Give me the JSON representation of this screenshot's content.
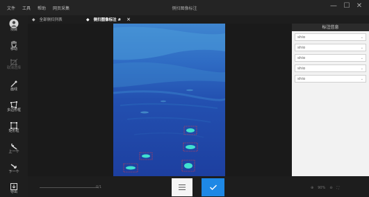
{
  "menu": [
    "文件",
    "工具",
    "帮助",
    "网页采集"
  ],
  "window_title": "侧扫图像标注",
  "window_controls": {
    "minimize": "—",
    "maximize": "☐",
    "close": "✕"
  },
  "tabs": [
    {
      "label": "全部侧扫列表",
      "active": false
    },
    {
      "label": "侧扫图像标注 #",
      "active": true,
      "close": "×"
    }
  ],
  "tools": [
    {
      "label": "项目",
      "icon": "avatar-icon",
      "enabled": true
    },
    {
      "label": "移动",
      "icon": "hand-icon",
      "enabled": true
    },
    {
      "label": "取消选择",
      "icon": "crop-icon",
      "enabled": false
    },
    {
      "label": "画线",
      "icon": "pen-icon",
      "enabled": true
    },
    {
      "label": "多边形框",
      "icon": "polygon-icon",
      "enabled": true
    },
    {
      "label": "矩形框",
      "icon": "rectangle-icon",
      "enabled": true
    },
    {
      "label": "上一个",
      "icon": "undo-icon",
      "enabled": true
    },
    {
      "label": "下一个",
      "icon": "redo-icon",
      "enabled": true
    },
    {
      "label": "导出",
      "icon": "export-icon",
      "enabled": true
    }
  ],
  "panel": {
    "title": "标注信息",
    "items": [
      "shio",
      "shio",
      "shio",
      "shio",
      "shio"
    ]
  },
  "bottom": {
    "slider_value": "0/1",
    "zoom_text": "90%"
  },
  "colors": {
    "accent": "#1e88e5",
    "background": "#2a2a2a",
    "annotation": "#ff3b3b"
  }
}
